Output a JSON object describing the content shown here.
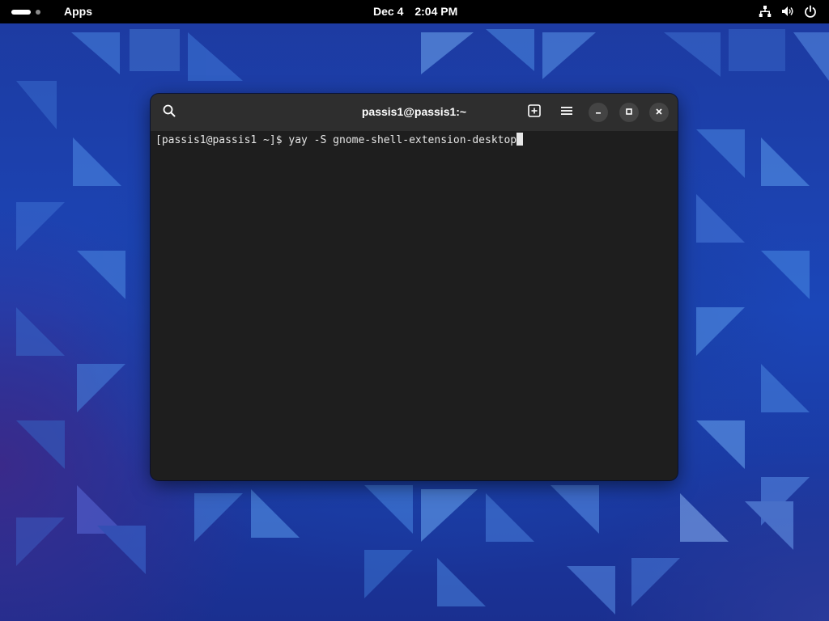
{
  "topbar": {
    "apps_label": "Apps",
    "date": "Dec 4",
    "time": "2:04 PM",
    "tray_icons": [
      "network-wired-icon",
      "volume-icon",
      "power-icon"
    ]
  },
  "terminal": {
    "title": "passis1@passis1:~",
    "prompt": "[passis1@passis1 ~]$ ",
    "command": "yay -S gnome-shell-extension-desktop",
    "headerbar_buttons": [
      "search-icon",
      "new-tab-icon",
      "hamburger-menu-icon",
      "minimize-icon",
      "maximize-icon",
      "close-icon"
    ]
  },
  "colors": {
    "topbar_bg": "#000000",
    "terminal_bg": "#1e1e1e",
    "headerbar_bg": "#2e2e2e",
    "text": "#e6e6e6",
    "wallpaper_accent": "#2c6ed8"
  }
}
